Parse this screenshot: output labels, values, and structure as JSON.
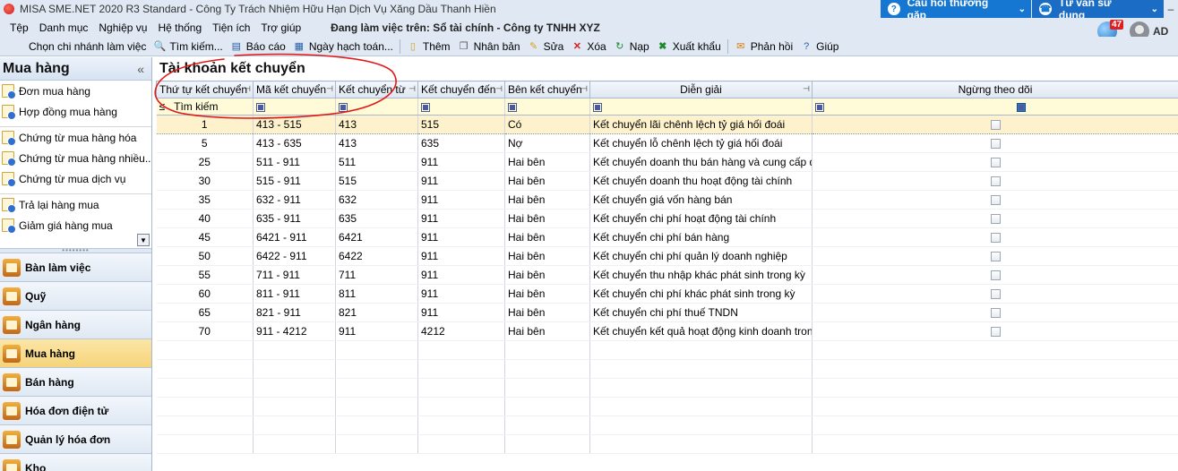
{
  "window": {
    "title": "MISA SME.NET 2020 R3 Standard - Công Ty Trách Nhiệm Hữu Hạn Dịch Vụ Xăng Dầu Thanh Hiền"
  },
  "top_buttons": {
    "faq": "Câu hỏi thường gặp",
    "guide": "Tư vấn sử dụng"
  },
  "menu": {
    "items": [
      "Tệp",
      "Danh mục",
      "Nghiệp vụ",
      "Hệ thống",
      "Tiện ích",
      "Trợ giúp"
    ],
    "working_on": "Đang làm việc trên: Sổ tài chính - Công ty TNHH XYZ"
  },
  "toolbar": {
    "choose_branch": "Chọn chi nhánh làm việc",
    "search": "Tìm kiếm...",
    "report": "Báo cáo",
    "posting_date": "Ngày hạch toán...",
    "add": "Thêm",
    "duplicate": "Nhân bản",
    "edit": "Sửa",
    "delete": "Xóa",
    "reload": "Nạp",
    "export": "Xuất khẩu",
    "feedback": "Phản hồi",
    "help": "Giúp"
  },
  "user": {
    "notifications": "47",
    "name": "AD"
  },
  "sidebar": {
    "title": "Mua hàng",
    "collapse": "«",
    "group1": [
      "Đơn mua hàng",
      "Hợp đồng mua hàng"
    ],
    "group2": [
      "Chứng từ mua hàng hóa",
      "Chứng từ mua hàng nhiều...",
      "Chứng từ mua dịch vụ"
    ],
    "group3": [
      "Trả lại hàng mua",
      "Giảm giá hàng mua"
    ],
    "modules": [
      "Bàn làm việc",
      "Quỹ",
      "Ngân hàng",
      "Mua hàng",
      "Bán hàng",
      "Hóa đơn điện tử",
      "Quản lý hóa đơn",
      "Kho"
    ],
    "active_module": "Mua hàng"
  },
  "main": {
    "title": "Tài khoản kết chuyển",
    "columns": [
      "Thứ tự kết chuyển",
      "Mã kết chuyển",
      "Kết chuyển từ",
      "Kết chuyển đến",
      "Bên kết chuyển",
      "Diễn giải",
      "Ngừng theo dõi"
    ],
    "filter": {
      "op": "≤",
      "search": "Tìm kiếm"
    },
    "rows": [
      [
        "1",
        "413 - 515",
        "413",
        "515",
        "Có",
        "Kết chuyển lãi chênh lệch tỷ giá hối đoái"
      ],
      [
        "5",
        "413 - 635",
        "413",
        "635",
        "Nợ",
        "Kết chuyển lỗ chênh lệch tỷ giá hối đoái"
      ],
      [
        "25",
        "511 - 911",
        "511",
        "911",
        "Hai bên",
        "Kết chuyển doanh thu bán hàng và cung cấp dị"
      ],
      [
        "30",
        "515 - 911",
        "515",
        "911",
        "Hai bên",
        "Kết chuyển doanh thu hoạt động tài chính"
      ],
      [
        "35",
        "632 - 911",
        "632",
        "911",
        "Hai bên",
        "Kết chuyển giá vốn hàng bán"
      ],
      [
        "40",
        "635 - 911",
        "635",
        "911",
        "Hai bên",
        "Kết chuyển chi phí hoạt động tài chính"
      ],
      [
        "45",
        "6421 - 911",
        "6421",
        "911",
        "Hai bên",
        "Kết chuyển chi phí bán hàng"
      ],
      [
        "50",
        "6422 - 911",
        "6422",
        "911",
        "Hai bên",
        "Kết chuyển chi phí quản lý doanh nghiệp"
      ],
      [
        "55",
        "711 - 911",
        "711",
        "911",
        "Hai bên",
        "Kết chuyển thu nhập khác phát sinh trong kỳ"
      ],
      [
        "60",
        "811 - 911",
        "811",
        "911",
        "Hai bên",
        "Kết chuyển chi phí khác phát sinh trong kỳ"
      ],
      [
        "65",
        "821 - 911",
        "821",
        "911",
        "Hai bên",
        "Kết chuyển chi phí thuế TNDN"
      ],
      [
        "70",
        "911 - 4212",
        "911",
        "4212",
        "Hai bên",
        "Kết chuyển kết quả hoạt động kinh doanh trong"
      ]
    ]
  },
  "colors": {
    "accent": "#1577d2",
    "selected_row": "#fdf2cc",
    "filter_row": "#fffbd8",
    "annotation": "#e01818"
  }
}
